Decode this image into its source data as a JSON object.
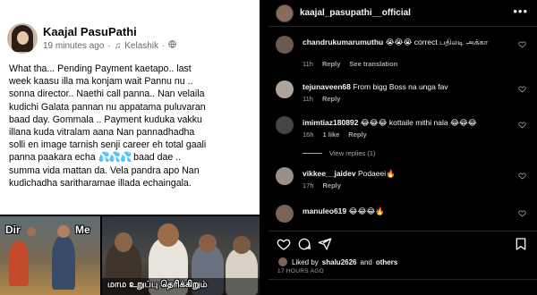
{
  "fb_post": {
    "author": "Kaajal PasuPathi",
    "time": "19 minutes ago",
    "music": "Kelashik",
    "body_lines": [
      "What tha... Pending Payment kaetapo.. last",
      "week kaasu illa ma konjam wait Pannu nu ..",
      "sonna director.. Naethi call panna.. Nan velaila",
      "kudichi Galata pannan nu appatama puluvaran",
      "baad day. Gommala .. Payment kuduka vakku",
      "illana kuda vitralam aana Nan pannadhadha",
      "solli en image tarnish senji career eh total gaali",
      "panna paakara echa",
      "summa vida mattan da.  Vela pandra apo Nan",
      "kudichadha saritharamae illada echaingala."
    ],
    "line8_tail": "baad dae ..",
    "drops": "💦💦💦",
    "meme_left": {
      "label_dir": "Dir",
      "label_me": "Me"
    },
    "meme_right": {
      "subtitle": "மாம உறுப்பு தெரிக்கிறும்"
    }
  },
  "instagram": {
    "header_username": "kaajal_pasupathi__official",
    "comments": [
      {
        "username": "chandrukumarumuthu",
        "text": "😭😭😭 correct பதிலடி அக்கா",
        "time": "11h",
        "likes": "",
        "reply": "Reply",
        "extra": "See translation",
        "avatar_color": "#6d5a4c"
      },
      {
        "username": "tejunaveen68",
        "text": "From bigg Boss na unga fav",
        "time": "11h",
        "likes": "",
        "reply": "Reply",
        "extra": "",
        "avatar_color": "#b0a59a"
      },
      {
        "username": "imimtiaz180892",
        "text": "😂😂😂 kottaile mithi nala 😂😂😂",
        "time": "16h",
        "likes": "1 like",
        "reply": "Reply",
        "extra": "",
        "avatar_color": "#444"
      },
      {
        "username": "vikkee__jaidev",
        "text": "Podaeei🔥",
        "time": "17h",
        "likes": "",
        "reply": "Reply",
        "extra": "",
        "avatar_color": "#9b8f86"
      },
      {
        "username": "manuleo619",
        "text": "😂😂😂🔥",
        "time": "",
        "likes": "",
        "reply": "",
        "extra": "",
        "avatar_color": "#7a6456"
      }
    ],
    "view_replies": "View replies (1)",
    "liked_by_prefix": "Liked by",
    "liked_by_user": "shalu2626",
    "liked_by_suffix": "and",
    "liked_by_others": "others",
    "time_ago": "17 HOURS AGO",
    "colors": {
      "accent_red": "#ff3040",
      "muted": "#a8a8a8"
    }
  }
}
